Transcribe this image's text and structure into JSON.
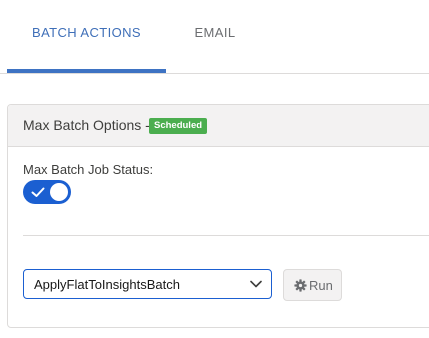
{
  "tabs": [
    {
      "label": "BATCH ACTIONS",
      "active": true
    },
    {
      "label": "EMAIL",
      "active": false
    }
  ],
  "card": {
    "title": "Max Batch Options -",
    "badge": "Scheduled",
    "status_label": "Max Batch Job Status:",
    "toggle_on": true,
    "select_value": "ApplyFlatToInsightsBatch",
    "run_label": "Run"
  },
  "colors": {
    "accent": "#3e73c3",
    "toggle": "#1b5fd1",
    "badge": "#4bae4f"
  },
  "icons": [
    "check-icon",
    "chevron-down-icon",
    "gear-icon"
  ]
}
